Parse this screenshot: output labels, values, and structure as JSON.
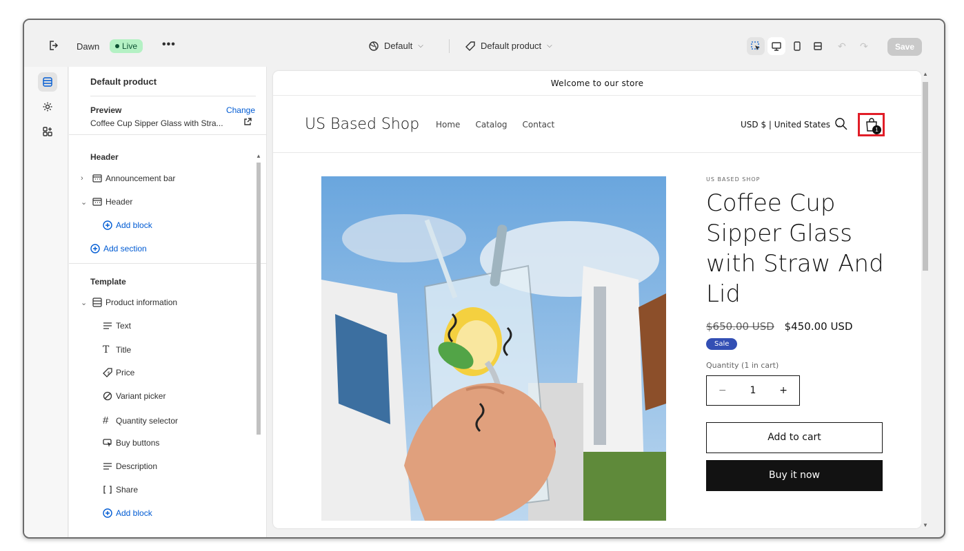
{
  "topbar": {
    "theme_name": "Dawn",
    "status": "Live",
    "more": "•••",
    "context_default": "Default",
    "context_template": "Default product",
    "save_label": "Save"
  },
  "sidebar": {
    "title": "Default product",
    "preview_label": "Preview",
    "change_label": "Change",
    "preview_value": "Coffee Cup Sipper Glass with Stra...",
    "header_section": "Header",
    "header_items": [
      {
        "label": "Announcement bar"
      },
      {
        "label": "Header"
      },
      {
        "label": "Add block"
      },
      {
        "label": "Add section"
      }
    ],
    "template_section": "Template",
    "template_group": "Product information",
    "blocks": [
      {
        "label": "Text"
      },
      {
        "label": "Title"
      },
      {
        "label": "Price"
      },
      {
        "label": "Variant picker"
      },
      {
        "label": "Quantity selector"
      },
      {
        "label": "Buy buttons"
      },
      {
        "label": "Description"
      },
      {
        "label": "Share"
      },
      {
        "label": "Add block"
      }
    ]
  },
  "store": {
    "announcement": "Welcome to our store",
    "logo": "US Based Shop",
    "nav": [
      "Home",
      "Catalog",
      "Contact"
    ],
    "country": "USD $ | United States",
    "cart_count": "1"
  },
  "product": {
    "vendor": "US BASED SHOP",
    "title": "Coffee Cup Sipper Glass with Straw And Lid",
    "compare_price": "$650.00 USD",
    "price": "$450.00 USD",
    "sale_badge": "Sale",
    "quantity_label": "Quantity (1 in cart)",
    "quantity_value": "1",
    "minus": "−",
    "plus": "+",
    "add_to_cart": "Add to cart",
    "buy_now": "Buy it now"
  },
  "colors": {
    "accent_blue": "#005bd3",
    "live_badge": "#b4f1c4",
    "sale_badge": "#334fb4",
    "cart_highlight": "#e11d27"
  }
}
